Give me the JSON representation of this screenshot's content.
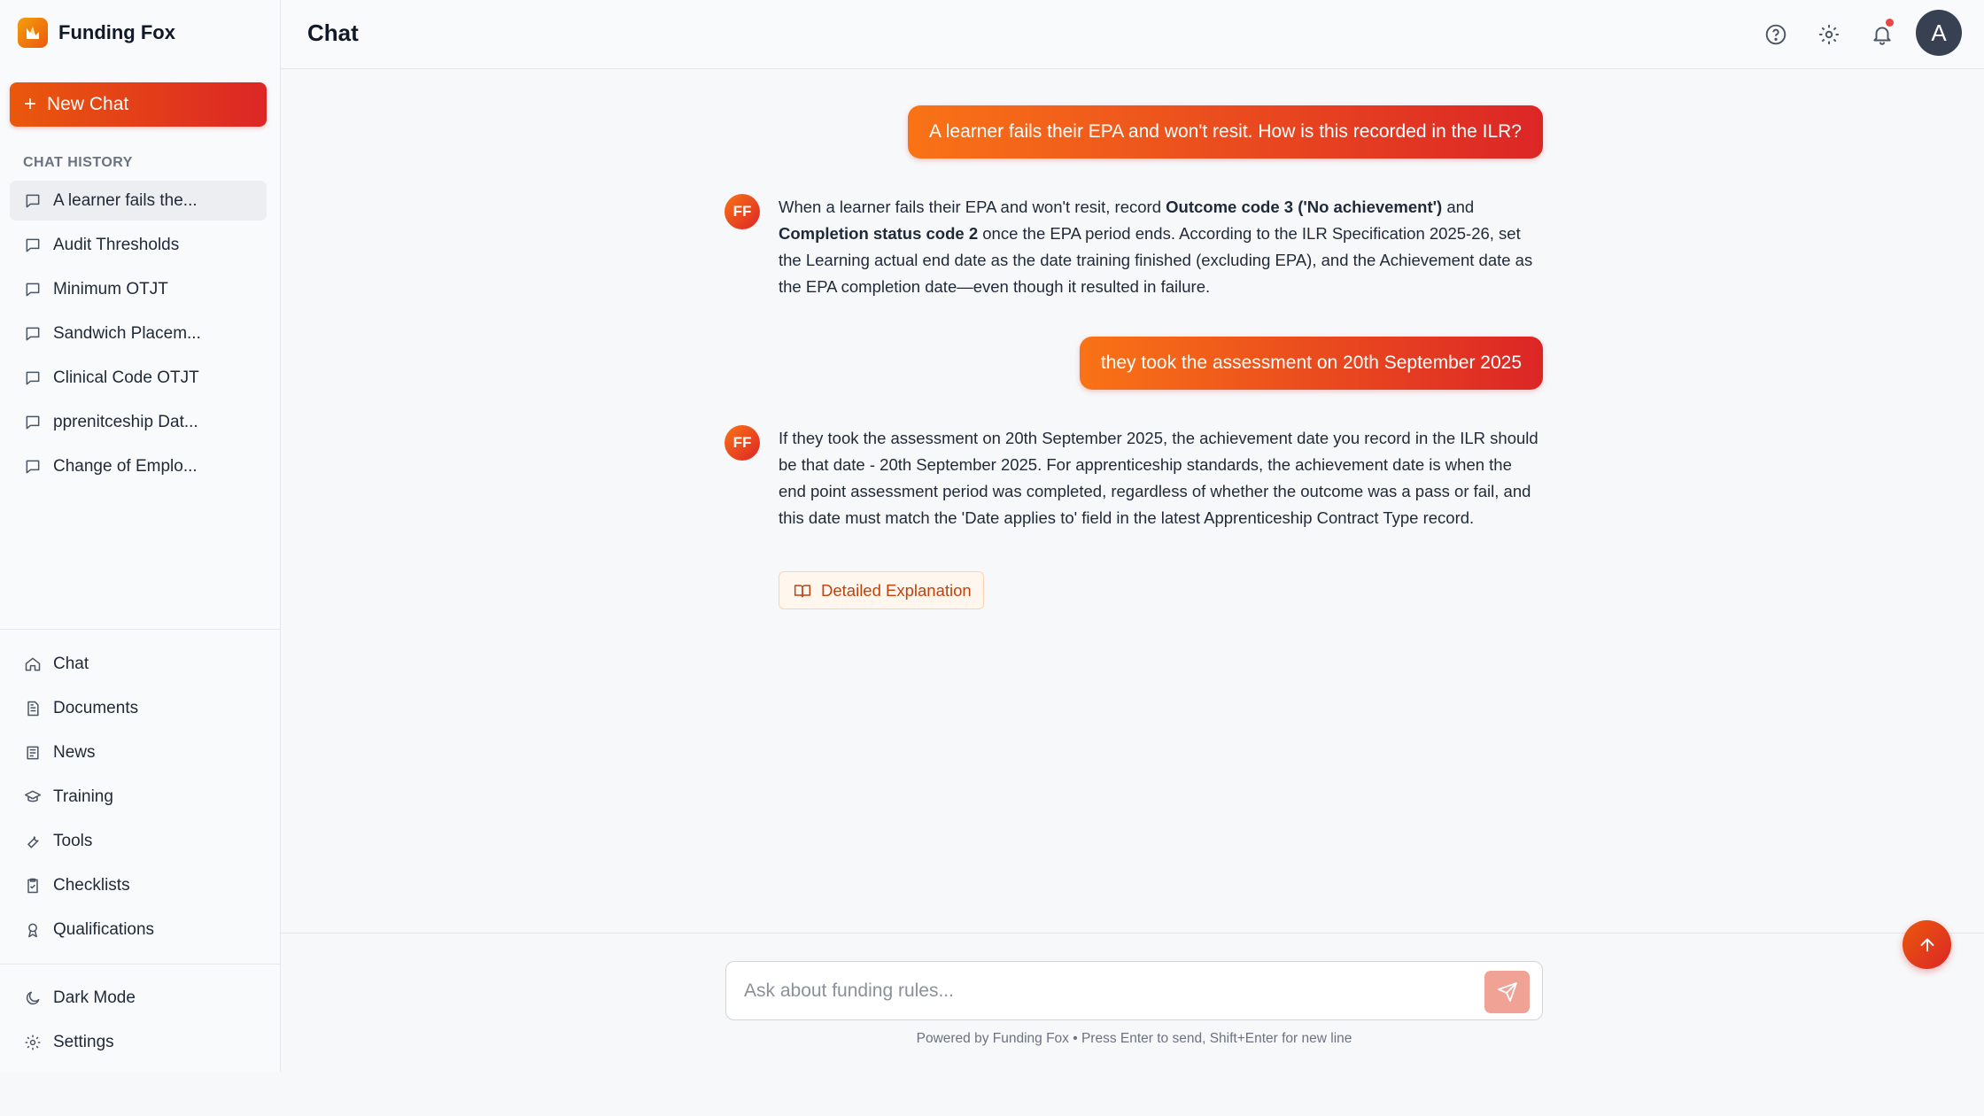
{
  "app": {
    "name": "Funding Fox"
  },
  "sidebar": {
    "new_chat_label": "New Chat",
    "history_label": "CHAT HISTORY",
    "history": [
      "A learner fails the...",
      "Audit Thresholds",
      "Minimum OTJT",
      "Sandwich Placem...",
      "Clinical Code OTJT",
      "pprenitceship Dat...",
      "Change of Emplo..."
    ],
    "nav": [
      "Chat",
      "Documents",
      "News",
      "Training",
      "Tools",
      "Checklists",
      "Qualifications"
    ],
    "bottom": [
      "Dark Mode",
      "Settings"
    ]
  },
  "header": {
    "title": "Chat",
    "avatar_initial": "A"
  },
  "messages": {
    "user1": "A learner fails their EPA and won't resit. How is this recorded in the ILR?",
    "bot_initials": "FF",
    "bot1": {
      "p1": "When a learner fails their EPA and won't resit, record ",
      "b1": "Outcome code 3 ('No achievement')",
      "p2": " and ",
      "b2": "Completion status code 2",
      "p3": " once the EPA period ends. According to the ILR Specification 2025-26, set the Learning actual end date as the date training finished (excluding EPA), and the Achievement date as the EPA completion date—even though it resulted in failure."
    },
    "user2": "they took the assessment on 20th September 2025",
    "bot2": "If they took the assessment on 20th September 2025, the achievement date you record in the ILR should be that date - 20th September 2025. For apprenticeship standards, the achievement date is when the end point assessment period was completed, regardless of whether the outcome was a pass or fail, and this date must match the 'Date applies to' field in the latest Apprenticeship Contract Type record.",
    "detail_button": "Detailed Explanation"
  },
  "composer": {
    "placeholder": "Ask about funding rules...",
    "footer": "Powered by Funding Fox • Press Enter to send, Shift+Enter for new line"
  },
  "colors": {
    "accent": "#ea580c",
    "accent_red": "#dc2626"
  }
}
